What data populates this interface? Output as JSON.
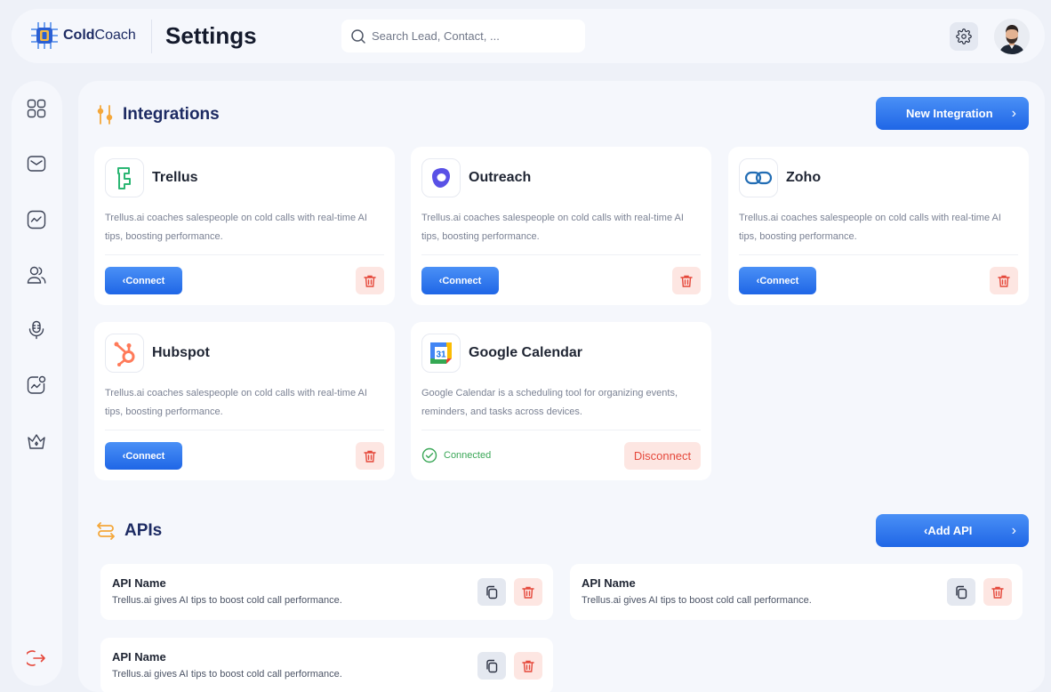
{
  "header": {
    "logo_bold": "Cold",
    "logo_light": "Coach",
    "page_title": "Settings",
    "search_placeholder": "Search Lead, Contact, ..."
  },
  "sidebar": {
    "items": [
      {
        "icon": "grid-icon"
      },
      {
        "icon": "mail-icon"
      },
      {
        "icon": "activity-icon"
      },
      {
        "icon": "users-icon"
      },
      {
        "icon": "microphone-icon"
      },
      {
        "icon": "analytics-icon"
      },
      {
        "icon": "crown-icon"
      }
    ],
    "logout_icon": "logout-icon"
  },
  "integrations": {
    "title": "Integrations",
    "new_button": "New Integration",
    "cards": [
      {
        "name": "Trellus",
        "desc": "Trellus.ai coaches salespeople on cold calls with real-time AI tips, boosting performance.",
        "action": "‹Connect"
      },
      {
        "name": "Outreach",
        "desc": "Trellus.ai coaches salespeople on cold calls with real-time AI tips, boosting performance.",
        "action": "‹Connect"
      },
      {
        "name": "Zoho",
        "desc": "Trellus.ai coaches salespeople on cold calls with real-time AI tips, boosting performance.",
        "action": "‹Connect"
      },
      {
        "name": "Hubspot",
        "desc": "Trellus.ai coaches salespeople on cold calls with real-time AI tips, boosting performance.",
        "action": "‹Connect"
      },
      {
        "name": "Google Calendar",
        "desc": "Google Calendar is a scheduling tool for organizing events, reminders, and tasks across devices.",
        "status": "Connected",
        "action": "Disconnect",
        "logo_day": "31"
      }
    ]
  },
  "apis": {
    "title": "APIs",
    "add_button": "‹Add API",
    "items": [
      {
        "name": "API Name",
        "desc": "Trellus.ai gives AI tips to boost cold call performance."
      },
      {
        "name": "API Name",
        "desc": "Trellus.ai gives AI tips to boost cold call performance."
      },
      {
        "name": "API Name",
        "desc": "Trellus.ai gives AI tips to boost cold call performance."
      }
    ]
  },
  "colors": {
    "primary": "#2b74ee",
    "danger": "#e5483b",
    "danger_bg": "#fde6e2",
    "success": "#3aa757",
    "accent_orange": "#f4a73a"
  }
}
